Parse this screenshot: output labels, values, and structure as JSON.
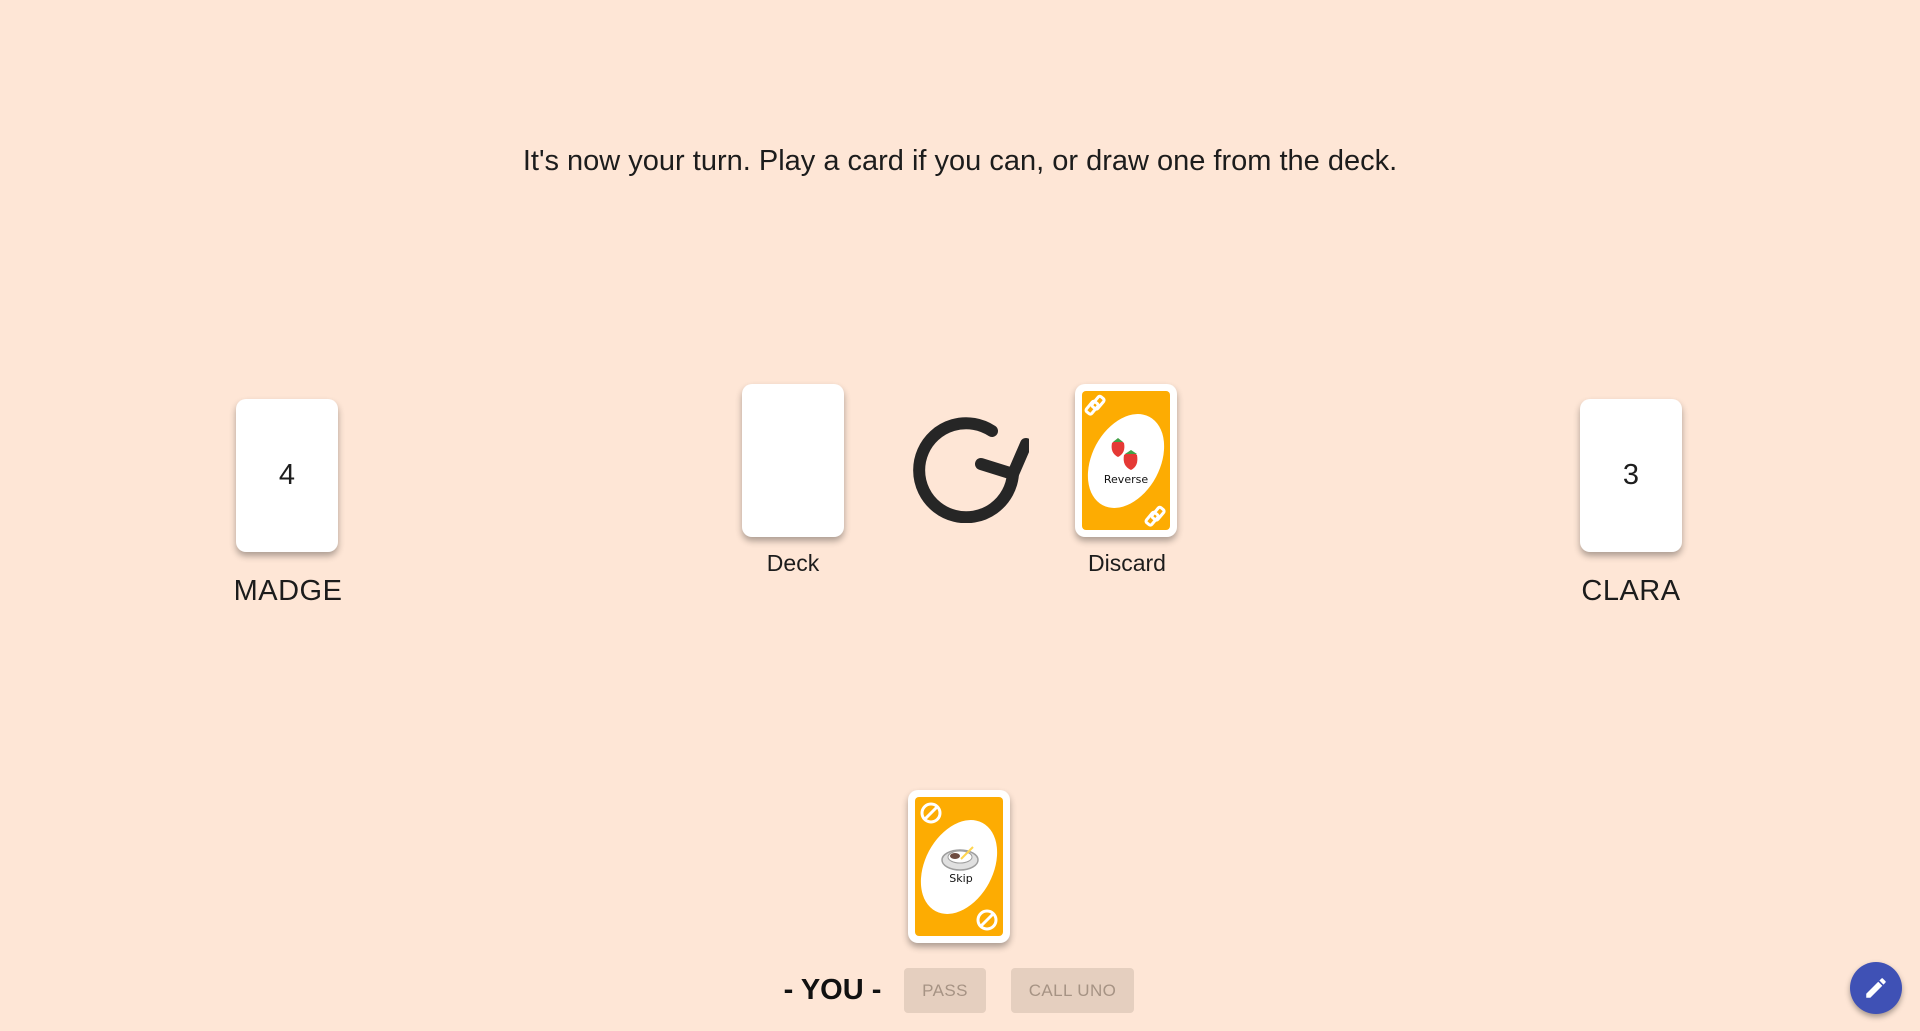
{
  "status": {
    "message": "It's now your turn. Play a card if you can, or draw one from the deck."
  },
  "opponents": [
    {
      "name": "MADGE",
      "card_count": "4"
    },
    {
      "name": "CLARA",
      "card_count": "3"
    }
  ],
  "table": {
    "deck_label": "Deck",
    "discard_label": "Discard",
    "direction_icon": "clockwise-arrow-icon",
    "discard_card": {
      "color": "#fdac02",
      "type": "reverse",
      "label": "Reverse"
    }
  },
  "hand": {
    "cards": [
      {
        "color": "#fdac02",
        "type": "skip",
        "label": "Skip"
      }
    ]
  },
  "controls": {
    "you_label": "- YOU -",
    "pass_label": "PASS",
    "call_uno_label": "CALL UNO"
  },
  "fab": {
    "icon": "pencil-icon"
  },
  "colors": {
    "background": "#fee6d6",
    "card_yellow": "#fdac02",
    "button_disabled_bg": "#e5cfbf",
    "button_disabled_text": "#a69384",
    "fab": "#3f51b5"
  }
}
